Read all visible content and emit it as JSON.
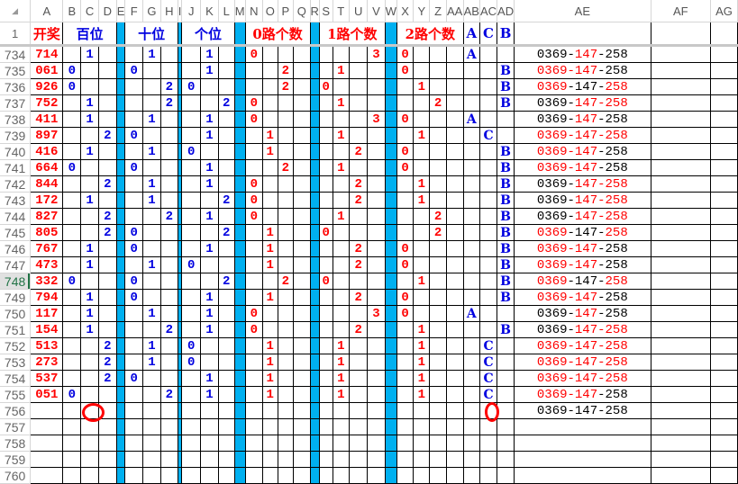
{
  "column_headers": [
    "A",
    "B",
    "C",
    "D",
    "E",
    "F",
    "G",
    "H",
    "I",
    "J",
    "K",
    "L",
    "M",
    "N",
    "O",
    "P",
    "Q",
    "R",
    "S",
    "T",
    "U",
    "V",
    "W",
    "X",
    "Y",
    "Z",
    "AA",
    "AB",
    "AC",
    "AD",
    "AE",
    "AF",
    "AG"
  ],
  "header_row": {
    "row": "1",
    "kaijiang": "开奖",
    "bai": "百位",
    "shi": "十位",
    "ge": "个位",
    "road0": "0路个数",
    "road1": "1路个数",
    "road2": "2路个数",
    "ab": "A",
    "ac": "C",
    "ad": "B"
  },
  "ae_sep": "-",
  "selected_row": "748",
  "rows": [
    {
      "row": "734",
      "draw": "714",
      "cells": {
        "C": "1",
        "G": "1",
        "K": "1",
        "N": "0",
        "V": "3",
        "X": "0",
        "AB": "A"
      },
      "ae": [
        "0369",
        "147",
        "258"
      ],
      "ae_red": [
        0,
        1,
        0
      ]
    },
    {
      "row": "735",
      "draw": "061",
      "cells": {
        "B": "0",
        "F": "0",
        "K": "1",
        "P": "2",
        "T": "1",
        "X": "0",
        "AD": "B"
      },
      "ae": [
        "0369",
        "147",
        "258"
      ],
      "ae_red": [
        1,
        1,
        0
      ]
    },
    {
      "row": "736",
      "draw": "926",
      "cells": {
        "B": "0",
        "H": "2",
        "J": "0",
        "P": "2",
        "S": "0",
        "Y": "1",
        "AD": "B"
      },
      "ae": [
        "0369",
        "147",
        "258"
      ],
      "ae_red": [
        1,
        0,
        1
      ]
    },
    {
      "row": "737",
      "draw": "752",
      "cells": {
        "C": "1",
        "H": "2",
        "L": "2",
        "N": "0",
        "T": "1",
        "Z": "2",
        "AD": "B"
      },
      "ae": [
        "0369",
        "147",
        "258"
      ],
      "ae_red": [
        0,
        1,
        1
      ]
    },
    {
      "row": "738",
      "draw": "411",
      "cells": {
        "C": "1",
        "G": "1",
        "K": "1",
        "N": "0",
        "V": "3",
        "X": "0",
        "AB": "A"
      },
      "ae": [
        "0369",
        "147",
        "258"
      ],
      "ae_red": [
        0,
        1,
        0
      ]
    },
    {
      "row": "739",
      "draw": "897",
      "cells": {
        "D": "2",
        "F": "0",
        "K": "1",
        "O": "1",
        "T": "1",
        "Y": "1",
        "AC": "C"
      },
      "ae": [
        "0369",
        "147",
        "258"
      ],
      "ae_red": [
        1,
        1,
        1
      ]
    },
    {
      "row": "740",
      "draw": "416",
      "cells": {
        "C": "1",
        "G": "1",
        "J": "0",
        "O": "1",
        "U": "2",
        "X": "0",
        "AD": "B"
      },
      "ae": [
        "0369",
        "147",
        "258"
      ],
      "ae_red": [
        1,
        1,
        0
      ]
    },
    {
      "row": "741",
      "draw": "664",
      "cells": {
        "B": "0",
        "F": "0",
        "K": "1",
        "P": "2",
        "T": "1",
        "X": "0",
        "AD": "B"
      },
      "ae": [
        "0369",
        "147",
        "258"
      ],
      "ae_red": [
        1,
        1,
        0
      ]
    },
    {
      "row": "742",
      "draw": "844",
      "cells": {
        "D": "2",
        "G": "1",
        "K": "1",
        "N": "0",
        "U": "2",
        "Y": "1",
        "AD": "B"
      },
      "ae": [
        "0369",
        "147",
        "258"
      ],
      "ae_red": [
        0,
        1,
        1
      ]
    },
    {
      "row": "743",
      "draw": "172",
      "cells": {
        "C": "1",
        "G": "1",
        "L": "2",
        "N": "0",
        "U": "2",
        "Y": "1",
        "AD": "B"
      },
      "ae": [
        "0369",
        "147",
        "258"
      ],
      "ae_red": [
        0,
        1,
        1
      ]
    },
    {
      "row": "744",
      "draw": "827",
      "cells": {
        "D": "2",
        "H": "2",
        "K": "1",
        "N": "0",
        "T": "1",
        "Z": "2",
        "AD": "B"
      },
      "ae": [
        "0369",
        "147",
        "258"
      ],
      "ae_red": [
        0,
        1,
        1
      ]
    },
    {
      "row": "745",
      "draw": "805",
      "cells": {
        "D": "2",
        "F": "0",
        "L": "2",
        "O": "1",
        "S": "0",
        "Z": "2",
        "AD": "B"
      },
      "ae": [
        "0369",
        "147",
        "258"
      ],
      "ae_red": [
        1,
        0,
        1
      ]
    },
    {
      "row": "746",
      "draw": "767",
      "cells": {
        "C": "1",
        "F": "0",
        "K": "1",
        "O": "1",
        "U": "2",
        "X": "0",
        "AD": "B"
      },
      "ae": [
        "0369",
        "147",
        "258"
      ],
      "ae_red": [
        1,
        1,
        0
      ]
    },
    {
      "row": "747",
      "draw": "473",
      "cells": {
        "C": "1",
        "G": "1",
        "J": "0",
        "O": "1",
        "U": "2",
        "X": "0",
        "AD": "B"
      },
      "ae": [
        "0369",
        "147",
        "258"
      ],
      "ae_red": [
        1,
        1,
        0
      ]
    },
    {
      "row": "748",
      "draw": "332",
      "cells": {
        "B": "0",
        "F": "0",
        "L": "2",
        "P": "2",
        "S": "0",
        "Y": "1",
        "AD": "B"
      },
      "ae": [
        "0369",
        "147",
        "258"
      ],
      "ae_red": [
        1,
        0,
        1
      ]
    },
    {
      "row": "749",
      "draw": "794",
      "cells": {
        "C": "1",
        "F": "0",
        "K": "1",
        "O": "1",
        "U": "2",
        "X": "0",
        "AD": "B"
      },
      "ae": [
        "0369",
        "147",
        "258"
      ],
      "ae_red": [
        1,
        1,
        0
      ]
    },
    {
      "row": "750",
      "draw": "117",
      "cells": {
        "C": "1",
        "G": "1",
        "K": "1",
        "N": "0",
        "V": "3",
        "X": "0",
        "AB": "A"
      },
      "ae": [
        "0369",
        "147",
        "258"
      ],
      "ae_red": [
        0,
        1,
        0
      ]
    },
    {
      "row": "751",
      "draw": "154",
      "cells": {
        "C": "1",
        "H": "2",
        "K": "1",
        "N": "0",
        "U": "2",
        "Y": "1",
        "AD": "B"
      },
      "ae": [
        "0369",
        "147",
        "258"
      ],
      "ae_red": [
        0,
        1,
        1
      ]
    },
    {
      "row": "752",
      "draw": "513",
      "cells": {
        "D": "2",
        "G": "1",
        "J": "0",
        "O": "1",
        "T": "1",
        "Y": "1",
        "AC": "C"
      },
      "ae": [
        "0369",
        "147",
        "258"
      ],
      "ae_red": [
        1,
        1,
        1
      ]
    },
    {
      "row": "753",
      "draw": "273",
      "cells": {
        "D": "2",
        "G": "1",
        "J": "0",
        "O": "1",
        "T": "1",
        "Y": "1",
        "AC": "C"
      },
      "ae": [
        "0369",
        "147",
        "258"
      ],
      "ae_red": [
        1,
        1,
        1
      ]
    },
    {
      "row": "754",
      "draw": "537",
      "cells": {
        "D": "2",
        "F": "0",
        "K": "1",
        "O": "1",
        "T": "1",
        "Y": "1",
        "AC": "C"
      },
      "ae": [
        "0369",
        "147",
        "258"
      ],
      "ae_red": [
        1,
        1,
        1
      ]
    },
    {
      "row": "755",
      "draw": "051",
      "cells": {
        "B": "0",
        "H": "2",
        "K": "1",
        "O": "1",
        "T": "1",
        "Y": "1",
        "AC": "C"
      },
      "ae": [
        "0369",
        "147",
        "258"
      ],
      "ae_red": [
        1,
        1,
        0
      ]
    },
    {
      "row": "756",
      "draw": "",
      "cells": {},
      "ae": [
        "0369",
        "147",
        "258"
      ],
      "ae_red": [
        0,
        0,
        0
      ]
    },
    {
      "row": "757",
      "draw": "",
      "cells": {}
    },
    {
      "row": "758",
      "draw": "",
      "cells": {}
    },
    {
      "row": "759",
      "draw": "",
      "cells": {}
    },
    {
      "row": "760",
      "draw": "",
      "cells": {}
    }
  ],
  "colors": {
    "red": "#ff0000",
    "blue": "#0000e0",
    "separator": "#00b0f0",
    "selected_row_header": "#217346"
  }
}
